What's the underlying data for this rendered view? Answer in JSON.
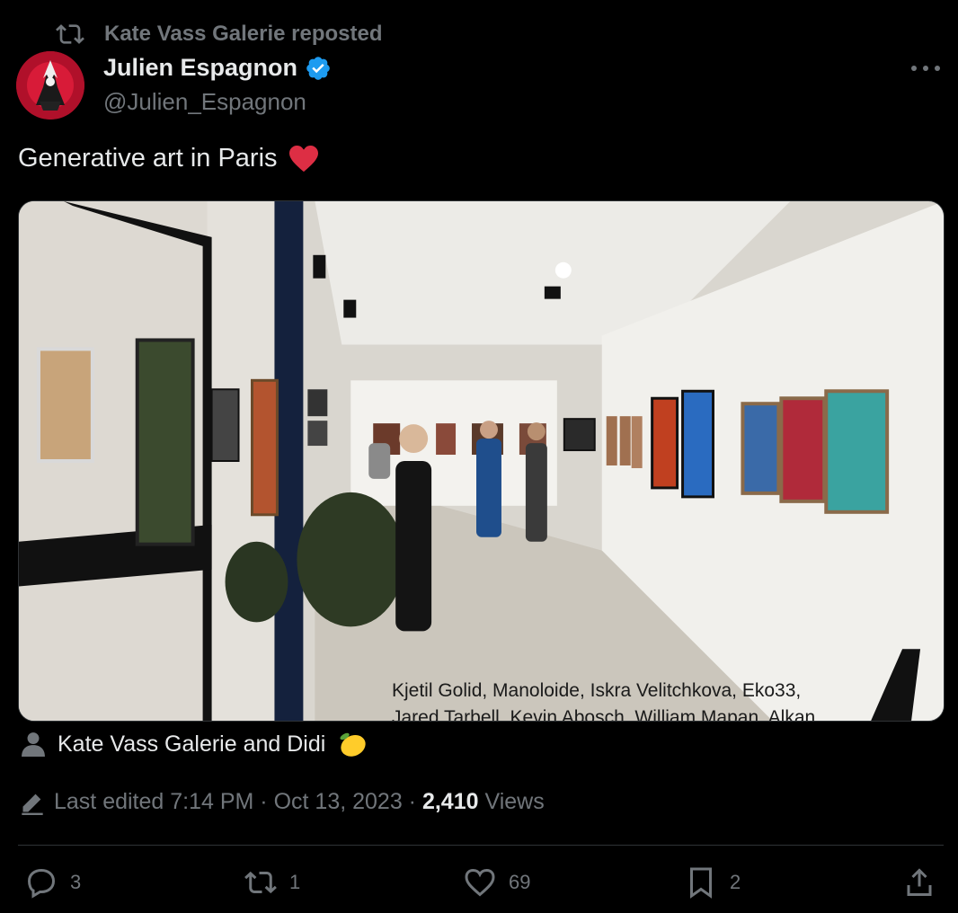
{
  "repost": {
    "text": "Kate Vass Galerie reposted",
    "icon": "repost-icon"
  },
  "author": {
    "name": "Julien Espagnon",
    "handle": "@Julien_Espagnon",
    "verified": true
  },
  "post": {
    "text": "Generative art in Paris",
    "emoji": "red-heart"
  },
  "media": {
    "caption_line1": "Kjetil Golid, Manoloide, Iskra Velitchkova, Eko33,",
    "caption_line2": "Jared Tarbell, Kevin Abosch, William Mapan, Alkan"
  },
  "tagged": {
    "text": "Kate Vass Galerie and Didi",
    "emoji": "lemon"
  },
  "meta": {
    "edited": "Last edited 7:14 PM · Oct 13, 2023 · ",
    "views_count": "2,410",
    "views_label": "Views"
  },
  "actions": {
    "replies": "3",
    "reposts": "1",
    "likes": "69",
    "bookmarks": "2"
  },
  "colors": {
    "background": "#000000",
    "text": "#e7e9ea",
    "muted": "#71767b",
    "verified": "#1d9bf0",
    "divider": "#2f3336"
  }
}
